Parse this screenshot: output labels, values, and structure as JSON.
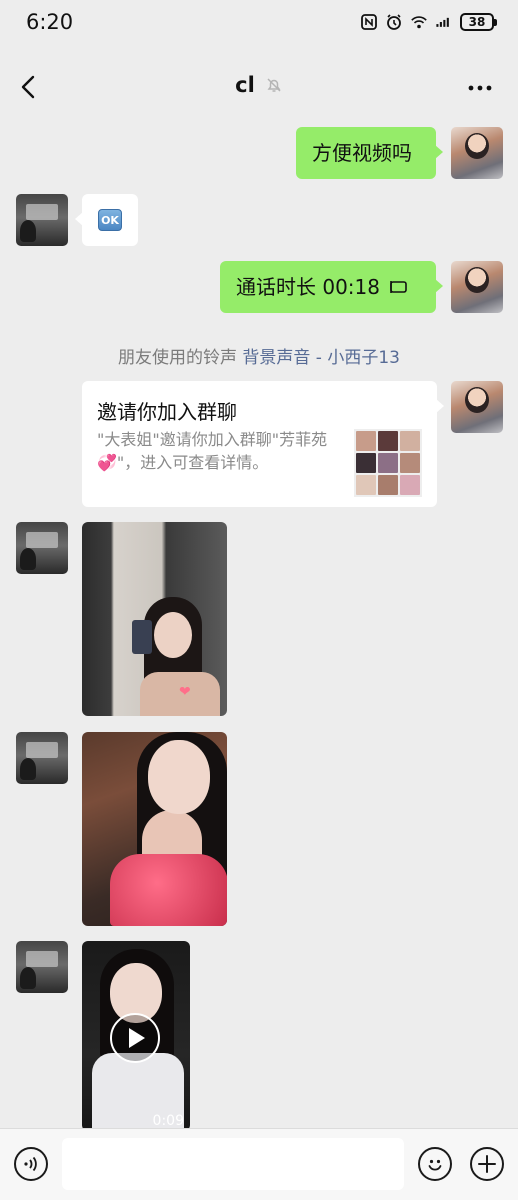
{
  "status_bar": {
    "time": "6:20",
    "battery": "38",
    "icons": [
      "nfc-icon",
      "alarm-icon",
      "wifi-icon",
      "signal-icon",
      "battery-icon"
    ]
  },
  "header": {
    "title": "cl",
    "muted_icon": "bell-muted-icon",
    "back_icon": "chevron-left-icon",
    "more_icon": "more-dots-icon"
  },
  "messages": [
    {
      "side": "me",
      "type": "text",
      "text": "方便视频吗"
    },
    {
      "side": "other",
      "type": "emoji",
      "emoji": "OK"
    },
    {
      "side": "me",
      "type": "call",
      "text": "通话时长 00:18",
      "icon": "video-call-icon"
    },
    {
      "side": "me",
      "type": "group_invite",
      "title": "邀请你加入群聊",
      "desc": "\"大表姐\"邀请你加入群聊\"芳菲苑💞\"，进入可查看详情。"
    },
    {
      "side": "other",
      "type": "image"
    },
    {
      "side": "other",
      "type": "image"
    },
    {
      "side": "other",
      "type": "video",
      "duration": "0:09"
    }
  ],
  "system_notice": {
    "prefix": "朋友使用的铃声 ",
    "link": "背景声音 - 小西子13"
  },
  "input_bar": {
    "placeholder": "",
    "voice_icon": "voice-icon",
    "emoji_icon": "emoji-icon",
    "plus_icon": "plus-icon"
  },
  "colors": {
    "background": "#ededed",
    "my_bubble": "#95ec69",
    "other_bubble": "#ffffff",
    "link": "#576b95"
  }
}
